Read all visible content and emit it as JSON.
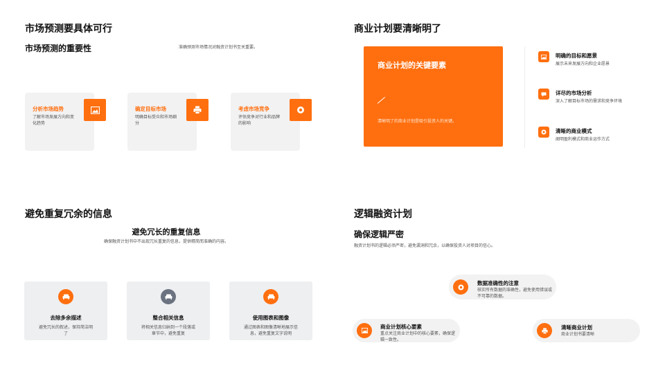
{
  "slide1": {
    "title": "市场预测要具体可行",
    "subtitle": "市场预测的重要性",
    "note": "准确预测市场情况对融资计划书至关重要。",
    "cards": [
      {
        "title": "分析市场趋势",
        "desc": "了解市场发展方向和变化趋势",
        "icon": "image-icon"
      },
      {
        "title": "确定目标市场",
        "desc": "明确目标受众和市场细分",
        "icon": "printer-icon"
      },
      {
        "title": "考虑市场竞争",
        "desc": "评估竞争对行业和品牌的影响",
        "icon": "target-icon"
      }
    ]
  },
  "slide2": {
    "title": "商业计划要清晰明了",
    "box_title": "商业计划的关键要素",
    "box_desc": "清晰明了的商业计划是吸引投资人的关键。",
    "items": [
      {
        "title": "明确的目标和愿景",
        "desc": "展示未来发展方向和企业愿景",
        "icon": "image-icon"
      },
      {
        "title": "详尽的市场分析",
        "desc": "深入了解目标市场的需求和竞争环境",
        "icon": "chat-icon"
      },
      {
        "title": "清晰的商业模式",
        "desc": "阐明盈利模式和商业运作方式",
        "icon": "target-icon"
      }
    ]
  },
  "slide3": {
    "title": "避免重复冗余的信息",
    "subtitle": "避免冗长的重复信息",
    "note": "确保融资计划书中不出现冗长重复的信息，提供精简而准确的内容。",
    "cards": [
      {
        "title": "去除多余描述",
        "desc": "避免冗长的叙述，保持简洁明了",
        "icon": "sofa-icon",
        "color": "#ff6f0f"
      },
      {
        "title": "整合相关信息",
        "desc": "将相关信息归纳到一个段落或章节中，避免重复",
        "icon": "sofa-icon",
        "color": "#6b7280"
      },
      {
        "title": "使用图表和图像",
        "desc": "通过图表和图像清晰地展示信息，避免重复文字说明",
        "icon": "sofa-icon",
        "color": "#ff6f0f"
      }
    ]
  },
  "slide4": {
    "title": "逻辑融资计划",
    "subtitle": "确保逻辑严密",
    "note": "融资计划书的逻辑必须严密，避免漏洞和冗余，以确保投资人对项目的信心。",
    "pills": [
      {
        "title": "数据准确性的注意",
        "desc": "核实所有数据的准确性，避免使用错误或不可靠的数据。",
        "icon": "target-icon"
      },
      {
        "title": "商业计划核心要素",
        "desc": "重点关注商业计划中的核心要素，确保逻辑一致性。",
        "icon": "image-icon"
      },
      {
        "title": "清晰商业计划",
        "desc": "商业计划书要清晰",
        "icon": "printer-icon"
      }
    ]
  },
  "colors": {
    "accent": "#ff6f0f",
    "card_bg": "#f2f2f2",
    "gray_icon": "#6b7280"
  }
}
